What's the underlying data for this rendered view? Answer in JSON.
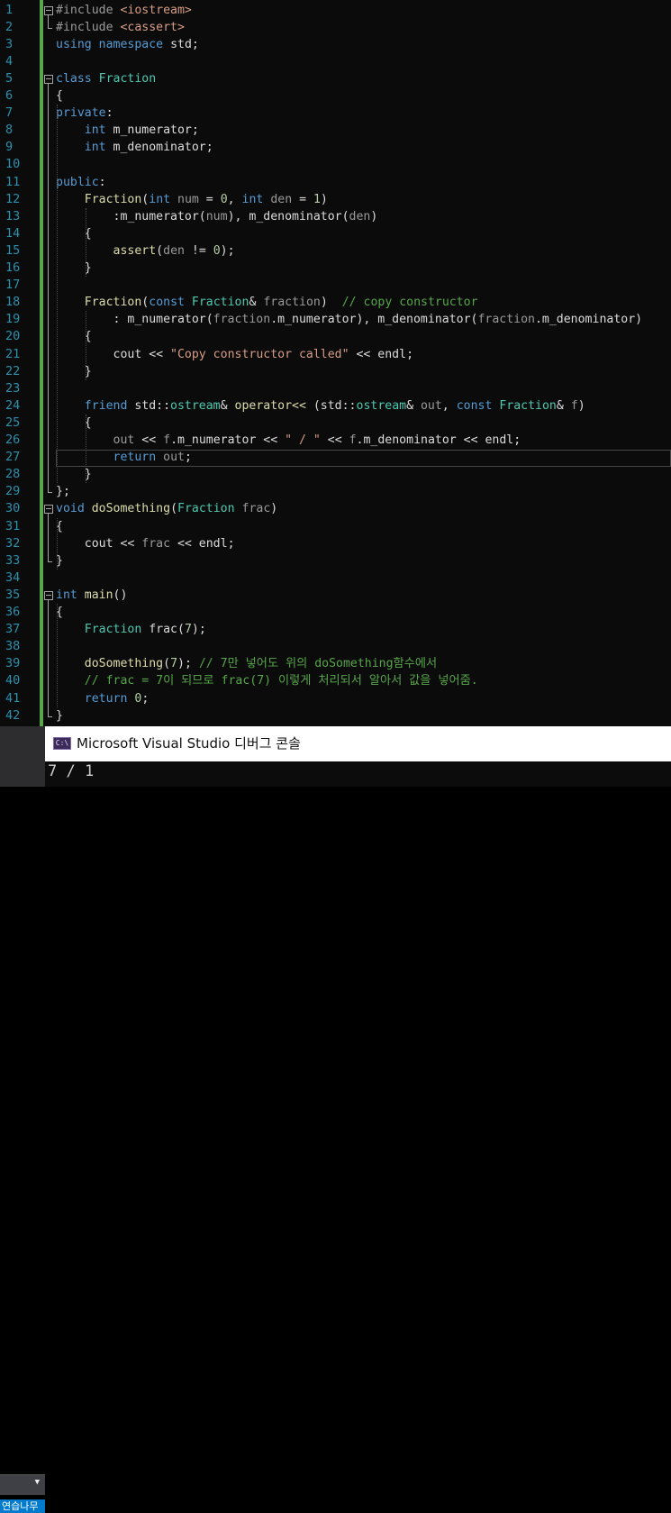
{
  "editor": {
    "line_numbers": [
      "1",
      "2",
      "3",
      "4",
      "5",
      "6",
      "7",
      "8",
      "9",
      "10",
      "11",
      "12",
      "13",
      "14",
      "15",
      "16",
      "17",
      "18",
      "19",
      "20",
      "21",
      "22",
      "23",
      "24",
      "25",
      "26",
      "27",
      "28",
      "29",
      "30",
      "31",
      "32",
      "33",
      "34",
      "35",
      "36",
      "37",
      "38",
      "39",
      "40",
      "41",
      "42"
    ],
    "lines": [
      [
        [
          "pp",
          "#include "
        ],
        [
          "str",
          "<iostream>"
        ]
      ],
      [
        [
          "pp",
          "#include "
        ],
        [
          "str",
          "<cassert>"
        ]
      ],
      [
        [
          "kw",
          "using"
        ],
        [
          "tx",
          " "
        ],
        [
          "kw",
          "namespace"
        ],
        [
          "tx",
          " std;"
        ]
      ],
      [],
      [
        [
          "kw",
          "class"
        ],
        [
          "tx",
          " "
        ],
        [
          "ty",
          "Fraction"
        ]
      ],
      [
        [
          "tx",
          "{"
        ]
      ],
      [
        [
          "kw",
          "private"
        ],
        [
          "tx",
          ":"
        ]
      ],
      [
        [
          "tx",
          "    "
        ],
        [
          "kw",
          "int"
        ],
        [
          "tx",
          " m_numerator;"
        ]
      ],
      [
        [
          "tx",
          "    "
        ],
        [
          "kw",
          "int"
        ],
        [
          "tx",
          " m_denominator;"
        ]
      ],
      [],
      [
        [
          "kw",
          "public"
        ],
        [
          "tx",
          ":"
        ]
      ],
      [
        [
          "tx",
          "    "
        ],
        [
          "fn",
          "Fraction"
        ],
        [
          "tx",
          "("
        ],
        [
          "kw",
          "int"
        ],
        [
          "tx",
          " "
        ],
        [
          "pm",
          "num"
        ],
        [
          "tx",
          " = "
        ],
        [
          "num",
          "0"
        ],
        [
          "tx",
          ", "
        ],
        [
          "kw",
          "int"
        ],
        [
          "tx",
          " "
        ],
        [
          "pm",
          "den"
        ],
        [
          "tx",
          " = "
        ],
        [
          "num",
          "1"
        ],
        [
          "tx",
          ")"
        ]
      ],
      [
        [
          "tx",
          "        :m_numerator("
        ],
        [
          "pm",
          "num"
        ],
        [
          "tx",
          "), m_denominator("
        ],
        [
          "pm",
          "den"
        ],
        [
          "tx",
          ")"
        ]
      ],
      [
        [
          "tx",
          "    {"
        ]
      ],
      [
        [
          "tx",
          "        "
        ],
        [
          "fn",
          "assert"
        ],
        [
          "tx",
          "("
        ],
        [
          "pm",
          "den"
        ],
        [
          "tx",
          " != "
        ],
        [
          "num",
          "0"
        ],
        [
          "tx",
          ");"
        ]
      ],
      [
        [
          "tx",
          "    }"
        ]
      ],
      [],
      [
        [
          "tx",
          "    "
        ],
        [
          "fn",
          "Fraction"
        ],
        [
          "tx",
          "("
        ],
        [
          "kw",
          "const"
        ],
        [
          "tx",
          " "
        ],
        [
          "ty",
          "Fraction"
        ],
        [
          "tx",
          "& "
        ],
        [
          "pm",
          "fraction"
        ],
        [
          "tx",
          ")  "
        ],
        [
          "cm",
          "// copy constructor"
        ]
      ],
      [
        [
          "tx",
          "        : m_numerator("
        ],
        [
          "pm",
          "fraction"
        ],
        [
          "tx",
          ".m_numerator), m_denominator("
        ],
        [
          "pm",
          "fraction"
        ],
        [
          "tx",
          ".m_denominator)"
        ]
      ],
      [
        [
          "tx",
          "    {"
        ]
      ],
      [
        [
          "tx",
          "        cout << "
        ],
        [
          "str",
          "\"Copy constructor called\""
        ],
        [
          "tx",
          " << endl;"
        ]
      ],
      [
        [
          "tx",
          "    }"
        ]
      ],
      [],
      [
        [
          "tx",
          "    "
        ],
        [
          "kw",
          "friend"
        ],
        [
          "tx",
          " std::"
        ],
        [
          "ty",
          "ostream"
        ],
        [
          "tx",
          "& "
        ],
        [
          "fn",
          "operator<<"
        ],
        [
          "tx",
          " (std::"
        ],
        [
          "ty",
          "ostream"
        ],
        [
          "tx",
          "& "
        ],
        [
          "pm",
          "out"
        ],
        [
          "tx",
          ", "
        ],
        [
          "kw",
          "const"
        ],
        [
          "tx",
          " "
        ],
        [
          "ty",
          "Fraction"
        ],
        [
          "tx",
          "& "
        ],
        [
          "pm",
          "f"
        ],
        [
          "tx",
          ")"
        ]
      ],
      [
        [
          "tx",
          "    {"
        ]
      ],
      [
        [
          "tx",
          "        "
        ],
        [
          "pm",
          "out"
        ],
        [
          "tx",
          " << "
        ],
        [
          "pm",
          "f"
        ],
        [
          "tx",
          ".m_numerator << "
        ],
        [
          "str",
          "\" / \""
        ],
        [
          "tx",
          " << "
        ],
        [
          "pm",
          "f"
        ],
        [
          "tx",
          ".m_denominator << endl;"
        ]
      ],
      [
        [
          "tx",
          "        "
        ],
        [
          "kw",
          "return"
        ],
        [
          "tx",
          " "
        ],
        [
          "pm",
          "out"
        ],
        [
          "tx",
          ";"
        ]
      ],
      [
        [
          "tx",
          "    }"
        ]
      ],
      [
        [
          "tx",
          "};"
        ]
      ],
      [
        [
          "kw",
          "void"
        ],
        [
          "tx",
          " "
        ],
        [
          "fn",
          "doSomething"
        ],
        [
          "tx",
          "("
        ],
        [
          "ty",
          "Fraction"
        ],
        [
          "tx",
          " "
        ],
        [
          "pm",
          "frac"
        ],
        [
          "tx",
          ")"
        ]
      ],
      [
        [
          "tx",
          "{"
        ]
      ],
      [
        [
          "tx",
          "    cout << "
        ],
        [
          "pm",
          "frac"
        ],
        [
          "tx",
          " << endl;"
        ]
      ],
      [
        [
          "tx",
          "}"
        ]
      ],
      [],
      [
        [
          "kw",
          "int"
        ],
        [
          "tx",
          " "
        ],
        [
          "fn",
          "main"
        ],
        [
          "tx",
          "()"
        ]
      ],
      [
        [
          "tx",
          "{"
        ]
      ],
      [
        [
          "tx",
          "    "
        ],
        [
          "ty",
          "Fraction"
        ],
        [
          "tx",
          " frac("
        ],
        [
          "num",
          "7"
        ],
        [
          "tx",
          ");"
        ]
      ],
      [],
      [
        [
          "tx",
          "    "
        ],
        [
          "fn",
          "doSomething"
        ],
        [
          "tx",
          "("
        ],
        [
          "num",
          "7"
        ],
        [
          "tx",
          "); "
        ],
        [
          "cm",
          "// 7만 넣어도 위의 doSomething함수에서"
        ]
      ],
      [
        [
          "tx",
          "    "
        ],
        [
          "cm",
          "// frac = 7이 되므로 frac(7) 이렇게 처리되서 알아서 값을 넣어줌."
        ]
      ],
      [
        [
          "tx",
          "    "
        ],
        [
          "kw",
          "return"
        ],
        [
          "tx",
          " "
        ],
        [
          "num",
          "0"
        ],
        [
          "tx",
          ";"
        ]
      ],
      [
        [
          "tx",
          "}"
        ]
      ]
    ]
  },
  "console": {
    "title": "Microsoft Visual Studio 디버그 콘솔",
    "icon_label": "C:\\",
    "output": "7 / 1"
  },
  "sidebar": {
    "dropdown_arrow": "▼",
    "bottom_text": "연습나무"
  }
}
